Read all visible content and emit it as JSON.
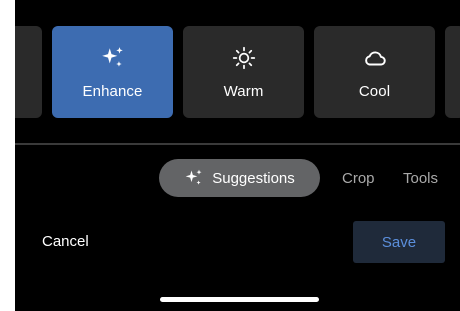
{
  "filters": {
    "items": [
      {
        "label": "Enhance",
        "icon": "sparkle-icon"
      },
      {
        "label": "Warm",
        "icon": "sun-icon"
      },
      {
        "label": "Cool",
        "icon": "cloud-icon"
      }
    ],
    "selected": "Enhance"
  },
  "tabs": {
    "active": {
      "label": "Suggestions",
      "icon": "sparkle-icon"
    },
    "items": [
      {
        "label": "Crop"
      },
      {
        "label": "Tools"
      }
    ]
  },
  "actions": {
    "cancel_label": "Cancel",
    "save_label": "Save"
  },
  "colors": {
    "selected_tile": "#3d6cb1",
    "tile": "#2a2a2a",
    "save_text": "#5b8fdc",
    "save_bg": "#1f2a3a",
    "pill": "#636466"
  }
}
